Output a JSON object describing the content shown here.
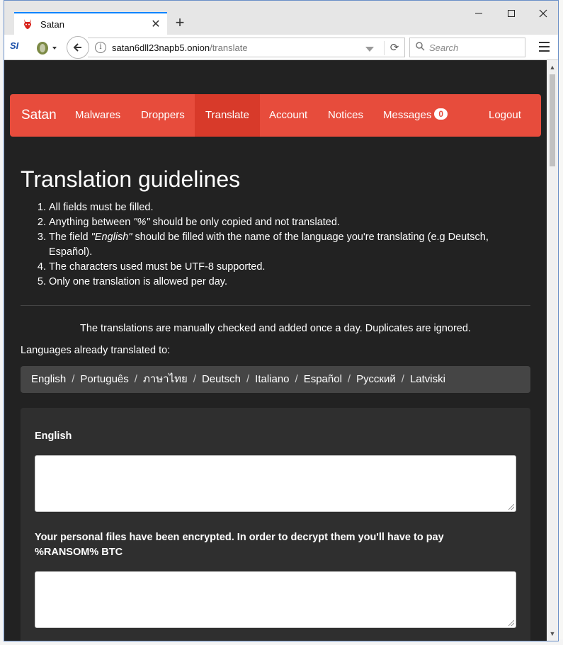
{
  "browser": {
    "tab_title": "Satan",
    "new_tab": "+",
    "tab_close": "✕",
    "window_min": "—",
    "window_max": "☐",
    "window_close": "✕",
    "url_host": "satan6dll23napb5.onion",
    "url_path": "/translate",
    "search_placeholder": "Search",
    "ext_label": "SI"
  },
  "nav": {
    "brand": "Satan",
    "items": [
      "Malwares",
      "Droppers",
      "Translate",
      "Account",
      "Notices",
      "Messages"
    ],
    "active": "Translate",
    "messages_count": "0",
    "logout": "Logout"
  },
  "page": {
    "title": "Translation guidelines",
    "guidelines": [
      "All fields must be filled.",
      "Anything between \"%\" should be only copied and not translated.",
      "The field \"English\" should be filled with the name of the language you're translating (e.g Deutsch, Español).",
      "The characters used must be UTF-8 supported.",
      "Only one translation is allowed per day."
    ],
    "guideline_2_pre": "Anything between ",
    "guideline_2_em": "\"%\"",
    "guideline_2_post": " should be only copied and not translated.",
    "guideline_3_pre": "The field ",
    "guideline_3_em": "\"English\"",
    "guideline_3_post": " should be filled with the name of the language you're translating (e.g Deutsch, Español).",
    "notice": "The translations are manually checked and added once a day. Duplicates are ignored.",
    "already_label": "Languages already translated to:",
    "languages": [
      "English",
      "Português",
      "ภาษาไทย",
      "Deutsch",
      "Italiano",
      "Español",
      "Русский",
      "Latviski"
    ],
    "separator": "/"
  },
  "form": {
    "field1_label": "English",
    "field1_value": "",
    "field2_label": "Your personal files have been encrypted. In order to decrypt them you'll have to pay %RANSOM% BTC",
    "field2_value": ""
  },
  "colors": {
    "accent": "#e74c3c",
    "background": "#222222",
    "panel": "#2f2f2f",
    "lang_bar": "#454545"
  }
}
